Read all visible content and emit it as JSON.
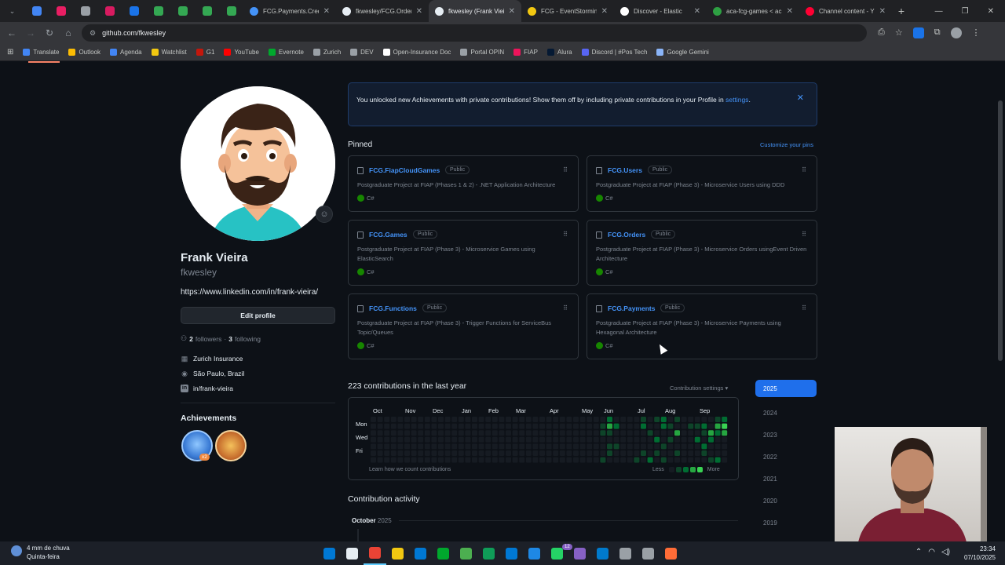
{
  "browser": {
    "tabs": [
      {
        "label": "FCG.Payments.Credi",
        "color": "#4493f8",
        "active": false
      },
      {
        "label": "fkwesley/FCG.Order",
        "color": "#e6edf3",
        "active": false
      },
      {
        "label": "fkwesley (Frank Viei",
        "color": "#e6edf3",
        "active": true
      },
      {
        "label": "FCG - EventStorming",
        "color": "#f2c811",
        "active": false
      },
      {
        "label": "Discover - Elastic",
        "color": "#ffffff",
        "active": false
      },
      {
        "label": "aca-fcg-games < ac",
        "color": "#2ea043",
        "active": false
      },
      {
        "label": "Channel content - Y",
        "color": "#ff0033",
        "active": false
      }
    ],
    "pinned_tab_colors": [
      "#4285f4",
      "#e91e63",
      "#9aa0a6",
      "#d81b60",
      "#1a73e8",
      "#34a853",
      "#34a853",
      "#34a853",
      "#34a853"
    ],
    "url": "github.com/fkwesley",
    "bookmarks": [
      {
        "label": "Translate",
        "color": "#4285f4"
      },
      {
        "label": "Outlook",
        "color": "#fbbc04"
      },
      {
        "label": "Agenda",
        "color": "#4285f4"
      },
      {
        "label": "Watchlist",
        "color": "#f2c811"
      },
      {
        "label": "G1",
        "color": "#c4170c"
      },
      {
        "label": "YouTube",
        "color": "#ff0000"
      },
      {
        "label": "Evernote",
        "color": "#00a82d"
      },
      {
        "label": "Zurich",
        "color": "#9aa0a6"
      },
      {
        "label": "DEV",
        "color": "#9aa0a6"
      },
      {
        "label": "Open-Insurance Doc",
        "color": "#ffffff"
      },
      {
        "label": "Portal OPIN",
        "color": "#9aa0a6"
      },
      {
        "label": "FIAP",
        "color": "#ed145b"
      },
      {
        "label": "Alura",
        "color": "#051933"
      },
      {
        "label": "Discord | #Pos Tech",
        "color": "#5865f2"
      },
      {
        "label": "Google Gemini",
        "color": "#8ab4f8"
      }
    ]
  },
  "profile": {
    "name": "Frank Vieira",
    "login": "fkwesley",
    "link": "https://www.linkedin.com/in/frank-vieira/",
    "edit_label": "Edit profile",
    "followers": "2",
    "followers_label": "followers",
    "dot": "·",
    "following": "3",
    "following_label": "following",
    "company": "Zurich Insurance",
    "location": "São Paulo, Brazil",
    "linkedin": "in/frank-vieira",
    "achievements_title": "Achievements",
    "achievement_multiplier": "x2"
  },
  "banner": {
    "text": "You unlocked new Achievements with private contributions! Show them off by including private contributions in your Profile in",
    "link": "settings",
    "after": "."
  },
  "pinned": {
    "title": "Pinned",
    "customize": "Customize your pins",
    "cards": [
      {
        "name": "FCG.FiapCloudGames",
        "visibility": "Public",
        "desc": "Postgraduate Project at FIAP (Phases 1 & 2) - .NET Application Architecture",
        "lang": "C#"
      },
      {
        "name": "FCG.Users",
        "visibility": "Public",
        "desc": "Postgraduate Project at FIAP (Phase 3) - Microservice Users using DDD",
        "lang": "C#"
      },
      {
        "name": "FCG.Games",
        "visibility": "Public",
        "desc": "Postgraduate Project at FIAP (Phase 3) - Microservice Games using ElasticSearch",
        "lang": "C#"
      },
      {
        "name": "FCG.Orders",
        "visibility": "Public",
        "desc": "Postgraduate Project at FIAP (Phase 3) - Microservice Orders usingEvent Driven Architecture",
        "lang": "C#"
      },
      {
        "name": "FCG.Functions",
        "visibility": "Public",
        "desc": "Postgraduate Project at FIAP (Phase 3) - Trigger Functions for ServiceBus Topic/Queues",
        "lang": "C#"
      },
      {
        "name": "FCG.Payments",
        "visibility": "Public",
        "desc": "Postgraduate Project at FIAP (Phase 3) - Microservice Payments using Hexagonal Architecture",
        "lang": "C#"
      }
    ]
  },
  "contributions": {
    "title": "223 contributions in the last year",
    "settings": "Contribution settings ▾",
    "months": [
      "Oct",
      "Nov",
      "Dec",
      "Jan",
      "Feb",
      "Mar",
      "Apr",
      "May",
      "Jun",
      "Jul",
      "Aug",
      "Sep"
    ],
    "days": [
      "Mon",
      "Wed",
      "Fri"
    ],
    "learn": "Learn how we count contributions",
    "less": "Less",
    "more": "More",
    "levels": [
      "#161b22",
      "#0e4429",
      "#006d32",
      "#26a641",
      "#39d353"
    ],
    "active_cells": [
      [
        34,
        1,
        1
      ],
      [
        34,
        2,
        1
      ],
      [
        34,
        6,
        1
      ],
      [
        35,
        0,
        2
      ],
      [
        35,
        1,
        3
      ],
      [
        35,
        2,
        1
      ],
      [
        35,
        4,
        1
      ],
      [
        35,
        5,
        1
      ],
      [
        36,
        1,
        2
      ],
      [
        36,
        4,
        1
      ],
      [
        39,
        6,
        1
      ],
      [
        40,
        0,
        1
      ],
      [
        40,
        1,
        2
      ],
      [
        40,
        5,
        1
      ],
      [
        41,
        2,
        1
      ],
      [
        41,
        6,
        2
      ],
      [
        42,
        0,
        1
      ],
      [
        42,
        3,
        2
      ],
      [
        42,
        5,
        1
      ],
      [
        43,
        0,
        2
      ],
      [
        43,
        1,
        2
      ],
      [
        43,
        4,
        1
      ],
      [
        43,
        6,
        1
      ],
      [
        44,
        1,
        1
      ],
      [
        44,
        3,
        1
      ],
      [
        45,
        0,
        1
      ],
      [
        45,
        2,
        3
      ],
      [
        45,
        5,
        1
      ],
      [
        47,
        1,
        1
      ],
      [
        48,
        1,
        1
      ],
      [
        48,
        3,
        2
      ],
      [
        49,
        1,
        2
      ],
      [
        49,
        2,
        1
      ],
      [
        49,
        4,
        2
      ],
      [
        49,
        5,
        1
      ],
      [
        50,
        2,
        3
      ],
      [
        50,
        3,
        2
      ],
      [
        50,
        6,
        1
      ],
      [
        51,
        0,
        1
      ],
      [
        51,
        1,
        3
      ],
      [
        51,
        2,
        2
      ],
      [
        51,
        6,
        2
      ],
      [
        52,
        0,
        2
      ],
      [
        52,
        1,
        4
      ],
      [
        52,
        2,
        3
      ]
    ],
    "years": [
      "2025",
      "2024",
      "2023",
      "2022",
      "2021",
      "2020",
      "2019"
    ]
  },
  "activity": {
    "title": "Contribution activity",
    "month": "October",
    "year": "2025"
  },
  "taskbar": {
    "weather": "4 mm de chuva",
    "weather_sub": "Quinta-feira",
    "time": "23:34",
    "date": "07/10/2025",
    "notification_count": "12",
    "app_colors": [
      "#0078d4",
      "#e6edf3",
      "#ea4335",
      "#f2c811",
      "#0078d4",
      "#00a82d",
      "#4caf50",
      "#0f9d58",
      "#0078d4",
      "#1e88e5",
      "#25d366",
      "#8661c5",
      "#007acc",
      "#9aa0a6",
      "#9aa0a6",
      "#ff6c37"
    ]
  }
}
